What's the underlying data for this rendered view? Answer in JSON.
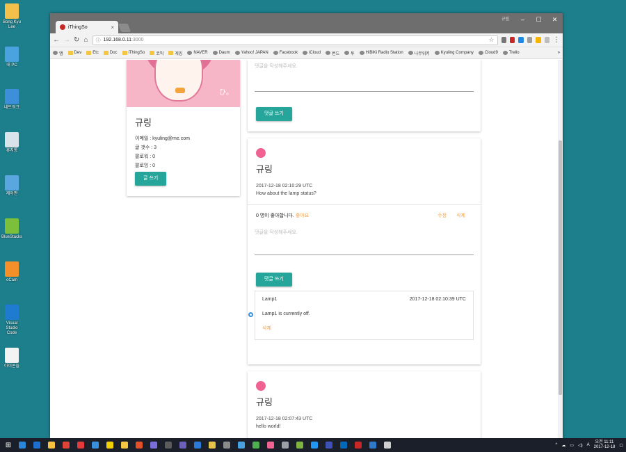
{
  "desktop": {
    "icons": [
      {
        "label": "Bong Kyu Lee",
        "color": "#f3c04b"
      },
      {
        "label": "내 PC",
        "color": "#4aa3df"
      },
      {
        "label": "네트워크",
        "color": "#3c8fd8"
      },
      {
        "label": "휴지통",
        "color": "#d9e3ea"
      },
      {
        "label": "제어판",
        "color": "#5aa7e0"
      },
      {
        "label": "BlueStacks",
        "color": "#7bbf3a"
      },
      {
        "label": "oCam",
        "color": "#f58f2a"
      },
      {
        "label": "Visual Studio Code",
        "color": "#1f7bd0"
      },
      {
        "label": "아이콘들",
        "color": "#f3f3f3"
      }
    ]
  },
  "browser": {
    "tab_title": "iThingSo",
    "window_user": "규림",
    "url_host": "192.168.0.11",
    "url_port": ":3000",
    "bookmarks": [
      {
        "label": "앱",
        "type": "apps"
      },
      {
        "label": "Dev",
        "type": "folder"
      },
      {
        "label": "Etc",
        "type": "folder"
      },
      {
        "label": "Doc",
        "type": "folder"
      },
      {
        "label": "iThingSo",
        "type": "folder"
      },
      {
        "label": "코믹",
        "type": "folder"
      },
      {
        "label": "게임",
        "type": "folder"
      },
      {
        "label": "NAVER",
        "type": "site"
      },
      {
        "label": "Daum",
        "type": "site"
      },
      {
        "label": "Yahoo! JAPAN",
        "type": "site"
      },
      {
        "label": "Facebook",
        "type": "site"
      },
      {
        "label": "iCloud",
        "type": "site"
      },
      {
        "label": "번드",
        "type": "site"
      },
      {
        "label": "투",
        "type": "site"
      },
      {
        "label": "HiBiKi Radio Station",
        "type": "site"
      },
      {
        "label": "나무위키",
        "type": "site"
      },
      {
        "label": "Kyuling Company",
        "type": "site"
      },
      {
        "label": "Cloud9",
        "type": "site"
      },
      {
        "label": "Trello",
        "type": "site"
      }
    ]
  },
  "profile": {
    "name": "규링",
    "email": "이메일 : kyuling@me.com",
    "posts": "글 갯수 : 3",
    "followers": "팔로워 : 0",
    "following": "팔로잉 : 0",
    "write_button": "글 쓰기"
  },
  "comment_placeholder": "댓글을 작성해주세요.",
  "comment_button": "댓글 쓰기",
  "posts": [
    {
      "author": "규링",
      "date": "2017-12-18 02:10:29 UTC",
      "content": "How about the lamp status?",
      "likes_text": "0 명이 좋아합니다.",
      "like_link": "좋아요",
      "edit": "수정",
      "delete": "삭제",
      "reply": {
        "author": "Lamp1",
        "date": "2017-12-18 02:10:39 UTC",
        "text": "Lamp1 is currently off.",
        "delete": "삭제"
      }
    },
    {
      "author": "규링",
      "date": "2017-12-18 02:07:43 UTC",
      "content": "hello world!"
    }
  ],
  "taskbar": {
    "apps": [
      "#2b86d8",
      "#1f6fd0",
      "#f4c542",
      "#db4437",
      "#e03a3a",
      "#3b8ed9",
      "#f5d000",
      "#f5c842",
      "#e14f2b",
      "#7a6fd8",
      "#5a5a5a",
      "#6c5fb7",
      "#2c7ad6",
      "#e6c14a",
      "#8a8a8a",
      "#4aa0e0",
      "#4fae4f",
      "#f06292",
      "#9aa0a6",
      "#7cb342",
      "#2196f3",
      "#3f51b5",
      "#0066b8",
      "#c62828",
      "#3178c6",
      "#cfcfcf"
    ],
    "time": "오전 11:11",
    "date": "2017-12-18"
  }
}
